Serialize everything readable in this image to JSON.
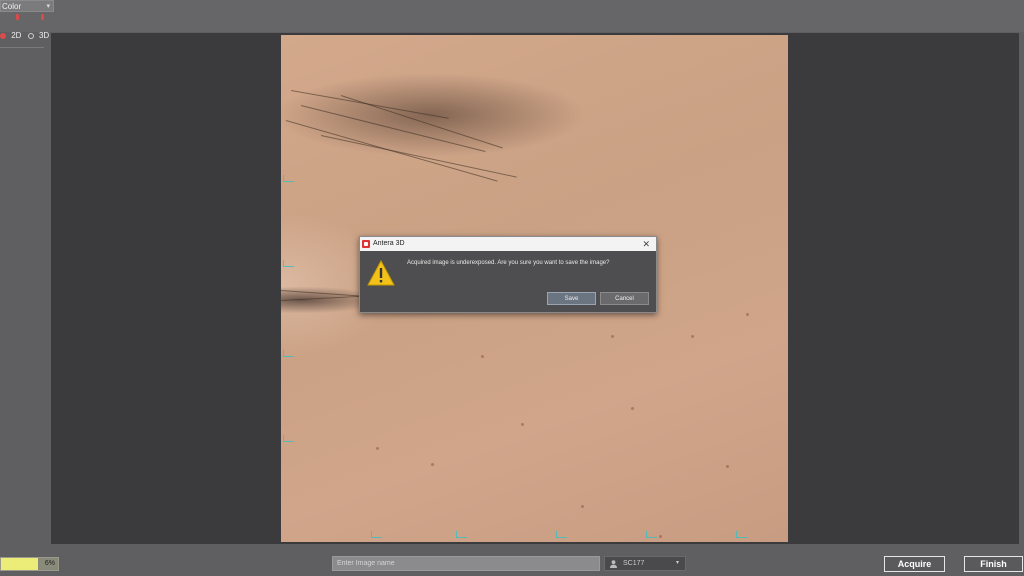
{
  "left_panel": {
    "mode_value": "Color",
    "mode_options": [
      "Color"
    ],
    "dimension_options": [
      {
        "label": "2D",
        "selected": true
      },
      {
        "label": "3D",
        "selected": false
      }
    ]
  },
  "dialog": {
    "title": "Antera 3D",
    "message": "Acquired image is underexposed. Are you sure you want to save the image?",
    "save_label": "Save",
    "cancel_label": "Cancel",
    "close_glyph": "✕",
    "icon": "warning-icon"
  },
  "bottom_bar": {
    "progress_text": "6%",
    "progress_fraction": 0.65,
    "name_placeholder": "Enter Image name",
    "user_value": "SC177",
    "acquire_label": "Acquire",
    "finish_label": "Finish"
  },
  "colors": {
    "accent_red": "#e04a4a",
    "progress_yellow": "#ecec78",
    "overlay_cyan": "#35c3c6"
  }
}
